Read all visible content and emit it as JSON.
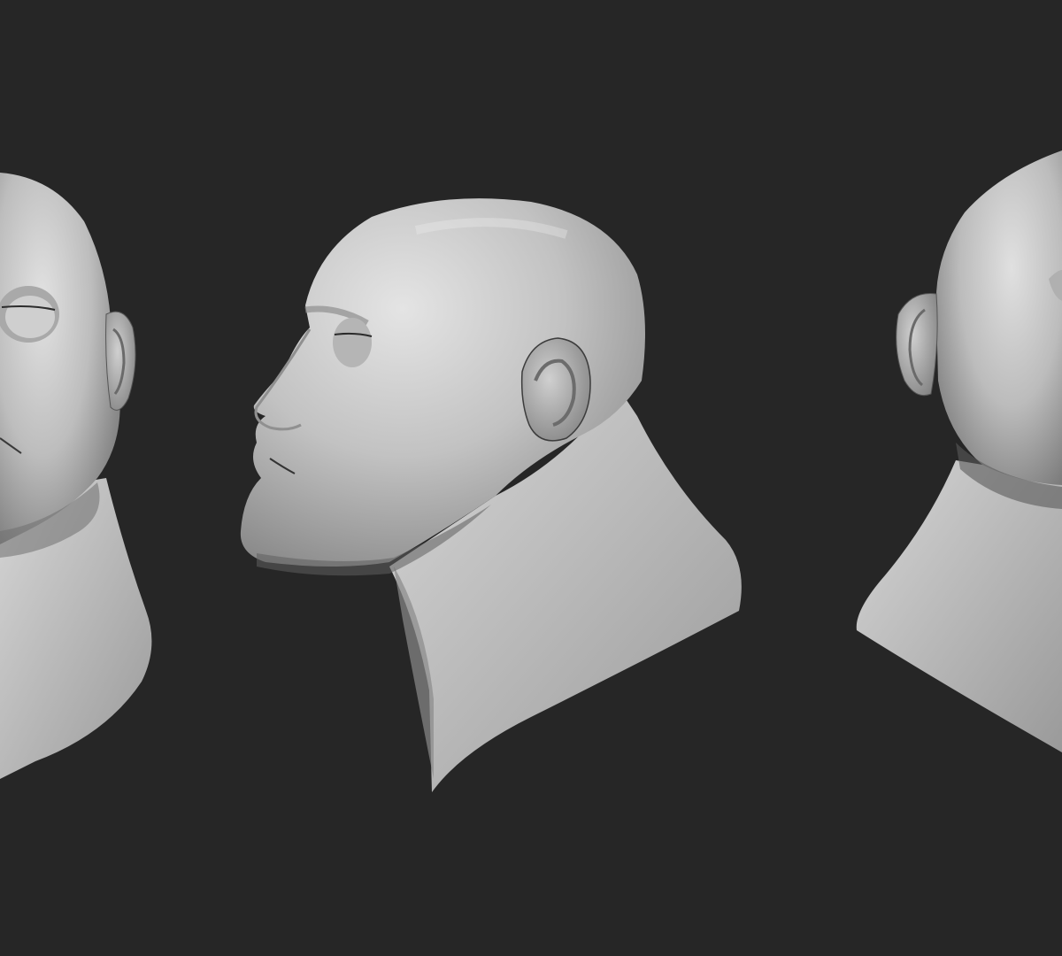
{
  "scene": {
    "background_color": "#262626",
    "material_color": "#c9c9c9",
    "views": [
      {
        "name": "three-quarter-left-view"
      },
      {
        "name": "profile-view"
      },
      {
        "name": "three-quarter-right-view"
      }
    ]
  }
}
